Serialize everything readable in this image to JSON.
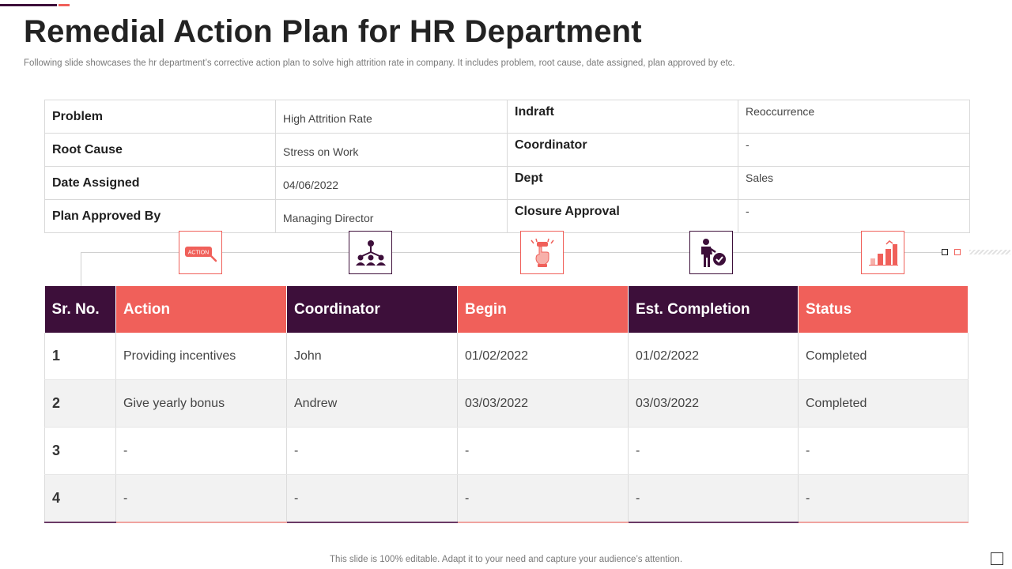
{
  "header": {
    "title": "Remedial Action Plan for HR Department",
    "subtitle": "Following slide showcases the hr department’s corrective action plan to solve high attrition rate in company. It includes problem, root cause, date assigned, plan approved by etc."
  },
  "info": {
    "rows": [
      {
        "left_label": "Problem",
        "left_value": "High Attrition Rate",
        "right_label": "Indraft",
        "right_value": "Reoccurrence"
      },
      {
        "left_label": "Root Cause",
        "left_value": "Stress on Work",
        "right_label": "Coordinator",
        "right_value": "-"
      },
      {
        "left_label": "Date Assigned",
        "left_value": "04/06/2022",
        "right_label": "Dept",
        "right_value": "Sales"
      },
      {
        "left_label": "Plan Approved By",
        "left_value": "Managing Director",
        "right_label": "Closure Approval",
        "right_value": "-"
      }
    ]
  },
  "icons": {
    "action_text": "ACTION",
    "names": [
      "action-sign-icon",
      "team-hierarchy-icon",
      "hand-press-icon",
      "approved-person-icon",
      "growth-chart-icon"
    ],
    "colors": {
      "red": "#f0605a",
      "purple": "#3d0f3a"
    }
  },
  "table": {
    "headers": [
      "Sr. No.",
      "Action",
      "Coordinator",
      "Begin",
      "Est. Completion",
      "Status"
    ],
    "rows": [
      [
        "1",
        "Providing incentives",
        "John",
        "01/02/2022",
        "01/02/2022",
        "Completed"
      ],
      [
        "2",
        "Give yearly bonus",
        "Andrew",
        "03/03/2022",
        "03/03/2022",
        "Completed"
      ],
      [
        "3",
        "-",
        "-",
        "-",
        "-",
        "-"
      ],
      [
        "4",
        "-",
        "-",
        "-",
        "-",
        "-"
      ]
    ]
  },
  "footer": {
    "text": "This slide is 100% editable. Adapt it to your need and capture your audience’s attention."
  }
}
